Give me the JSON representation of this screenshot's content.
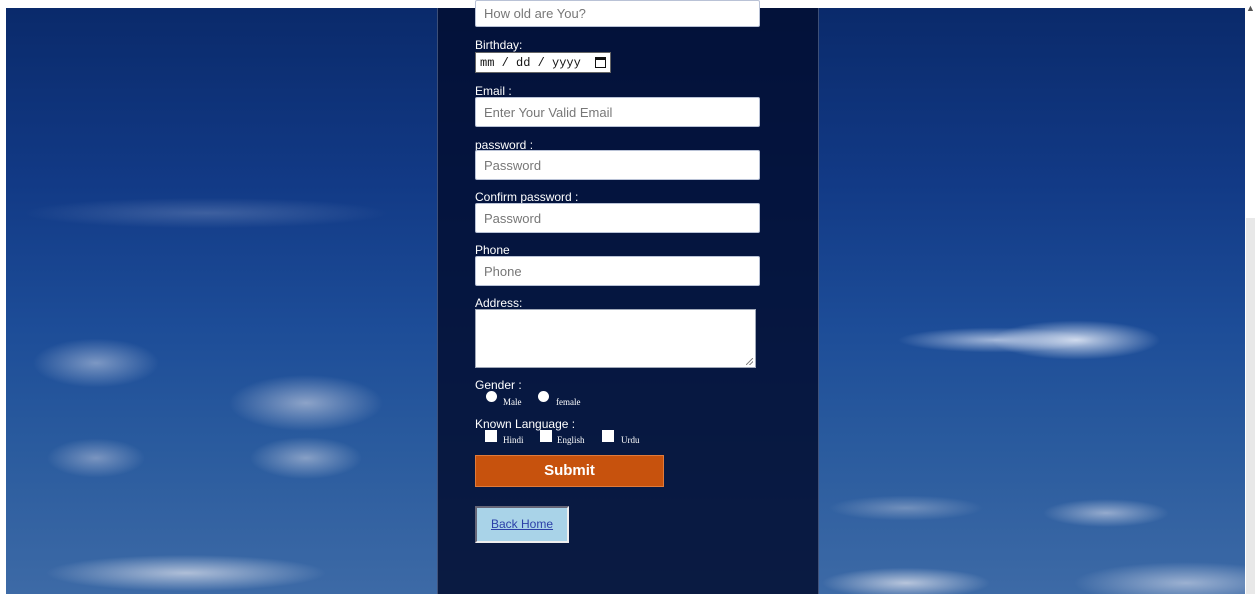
{
  "age": {
    "placeholder": "How old are You?"
  },
  "birthday": {
    "label": "Birthday:",
    "value": "mm / dd / yyyy"
  },
  "email": {
    "label": "Email :",
    "placeholder": "Enter Your Valid Email"
  },
  "password": {
    "label": "password :",
    "placeholder": "Password"
  },
  "confirm_password": {
    "label": "Confirm password :",
    "placeholder": "Password"
  },
  "phone": {
    "label": "Phone",
    "placeholder": "Phone"
  },
  "address": {
    "label": "Address:"
  },
  "gender": {
    "label": "Gender :",
    "options": [
      "Male",
      "female"
    ]
  },
  "languages": {
    "label": "Known Language :",
    "options": [
      "Hindi",
      "English",
      "Urdu"
    ]
  },
  "submit_label": "Submit",
  "back_home_label": "Back Home",
  "icons": {
    "calendar": "calendar-icon",
    "scroll_up": "chevron-up-icon"
  },
  "colors": {
    "submit": "#c7520d",
    "panel": "#020e32",
    "back_home_bg": "#a9d3e8"
  }
}
